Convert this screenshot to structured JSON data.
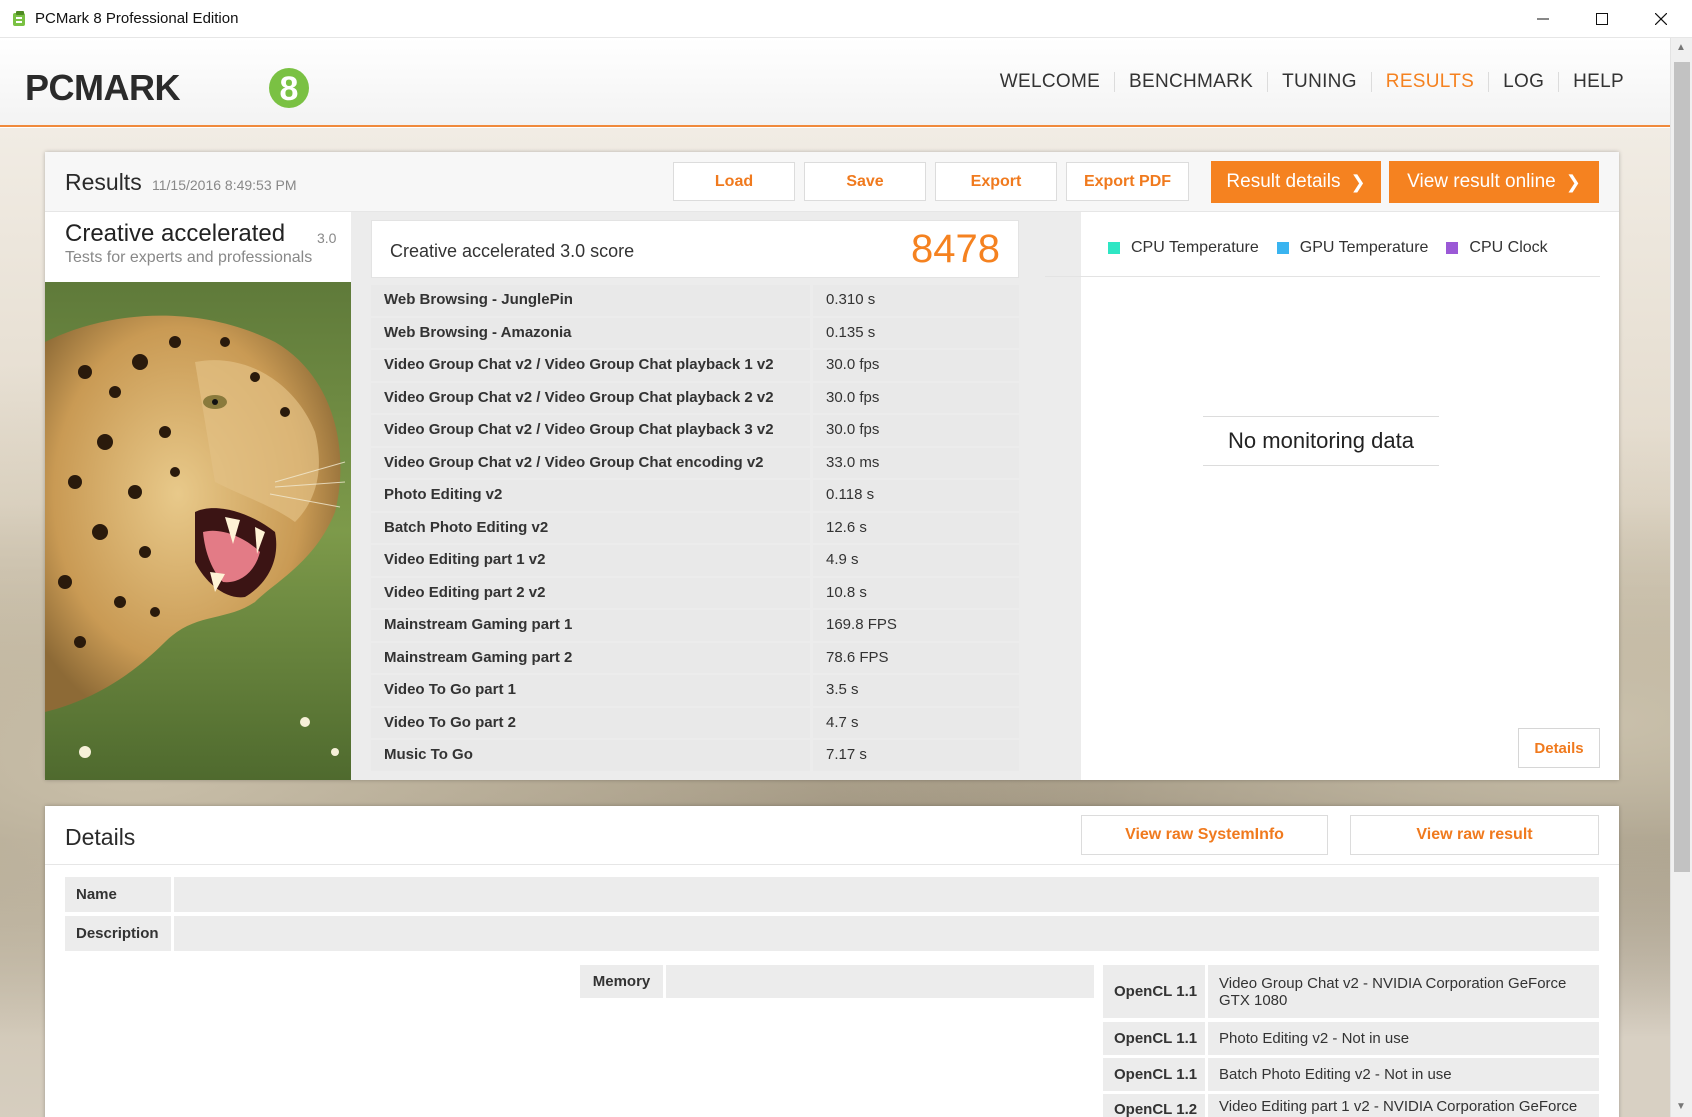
{
  "window": {
    "title": "PCMark 8 Professional Edition",
    "minimize": "—",
    "maximize": "☐",
    "close": "✕"
  },
  "header": {
    "logo_text": "PCMARK",
    "logo_number": "8",
    "nav": [
      {
        "label": "WELCOME",
        "active": false
      },
      {
        "label": "BENCHMARK",
        "active": false
      },
      {
        "label": "TUNING",
        "active": false
      },
      {
        "label": "RESULTS",
        "active": true
      },
      {
        "label": "LOG",
        "active": false
      },
      {
        "label": "HELP",
        "active": false
      }
    ]
  },
  "results": {
    "title": "Results",
    "date": "11/15/2016 8:49:53 PM",
    "buttons": {
      "load": "Load",
      "save": "Save",
      "export": "Export",
      "export_pdf": "Export PDF",
      "result_details": "Result details",
      "view_online": "View result online"
    },
    "test": {
      "name": "Creative accelerated",
      "version": "3.0",
      "subtitle": "Tests for experts and professionals"
    },
    "score_label": "Creative accelerated 3.0 score",
    "score_value": "8478",
    "rows": [
      {
        "name": "Web Browsing - JunglePin",
        "value": "0.310 s"
      },
      {
        "name": "Web Browsing - Amazonia",
        "value": "0.135 s"
      },
      {
        "name": "Video Group Chat v2 / Video Group Chat playback 1 v2",
        "value": "30.0 fps"
      },
      {
        "name": "Video Group Chat v2 / Video Group Chat playback 2 v2",
        "value": "30.0 fps"
      },
      {
        "name": "Video Group Chat v2 / Video Group Chat playback 3 v2",
        "value": "30.0 fps"
      },
      {
        "name": "Video Group Chat v2 / Video Group Chat encoding v2",
        "value": "33.0 ms"
      },
      {
        "name": "Photo Editing v2",
        "value": "0.118 s"
      },
      {
        "name": "Batch Photo Editing v2",
        "value": "12.6 s"
      },
      {
        "name": "Video Editing part 1 v2",
        "value": "4.9 s"
      },
      {
        "name": "Video Editing part 2 v2",
        "value": "10.8 s"
      },
      {
        "name": "Mainstream Gaming part 1",
        "value": "169.8 FPS"
      },
      {
        "name": "Mainstream Gaming part 2",
        "value": "78.6 FPS"
      },
      {
        "name": "Video To Go part 1",
        "value": "3.5 s"
      },
      {
        "name": "Video To Go part 2",
        "value": "4.7 s"
      },
      {
        "name": "Music To Go",
        "value": "7.17 s"
      }
    ],
    "legend": [
      {
        "label": "CPU Temperature",
        "color": "#2ee6c4"
      },
      {
        "label": "GPU Temperature",
        "color": "#3ab4f0"
      },
      {
        "label": "CPU Clock",
        "color": "#9b59d6"
      }
    ],
    "no_monitoring": "No monitoring data",
    "details_button": "Details"
  },
  "details": {
    "title": "Details",
    "view_systeminfo": "View raw SystemInfo",
    "view_raw_result": "View raw result",
    "name_label": "Name",
    "name_value": "",
    "description_label": "Description",
    "description_value": "",
    "memory_label": "Memory",
    "memory_value": "",
    "opencl": [
      {
        "api": "OpenCL 1.1",
        "text": "Video Group Chat v2 - NVIDIA Corporation GeForce GTX 1080"
      },
      {
        "api": "OpenCL 1.1",
        "text": "Photo Editing v2 - Not in use"
      },
      {
        "api": "OpenCL 1.1",
        "text": "Batch Photo Editing v2 - Not in use"
      },
      {
        "api": "OpenCL 1.2",
        "text": "Video Editing part 1 v2 - NVIDIA Corporation GeForce"
      }
    ]
  }
}
